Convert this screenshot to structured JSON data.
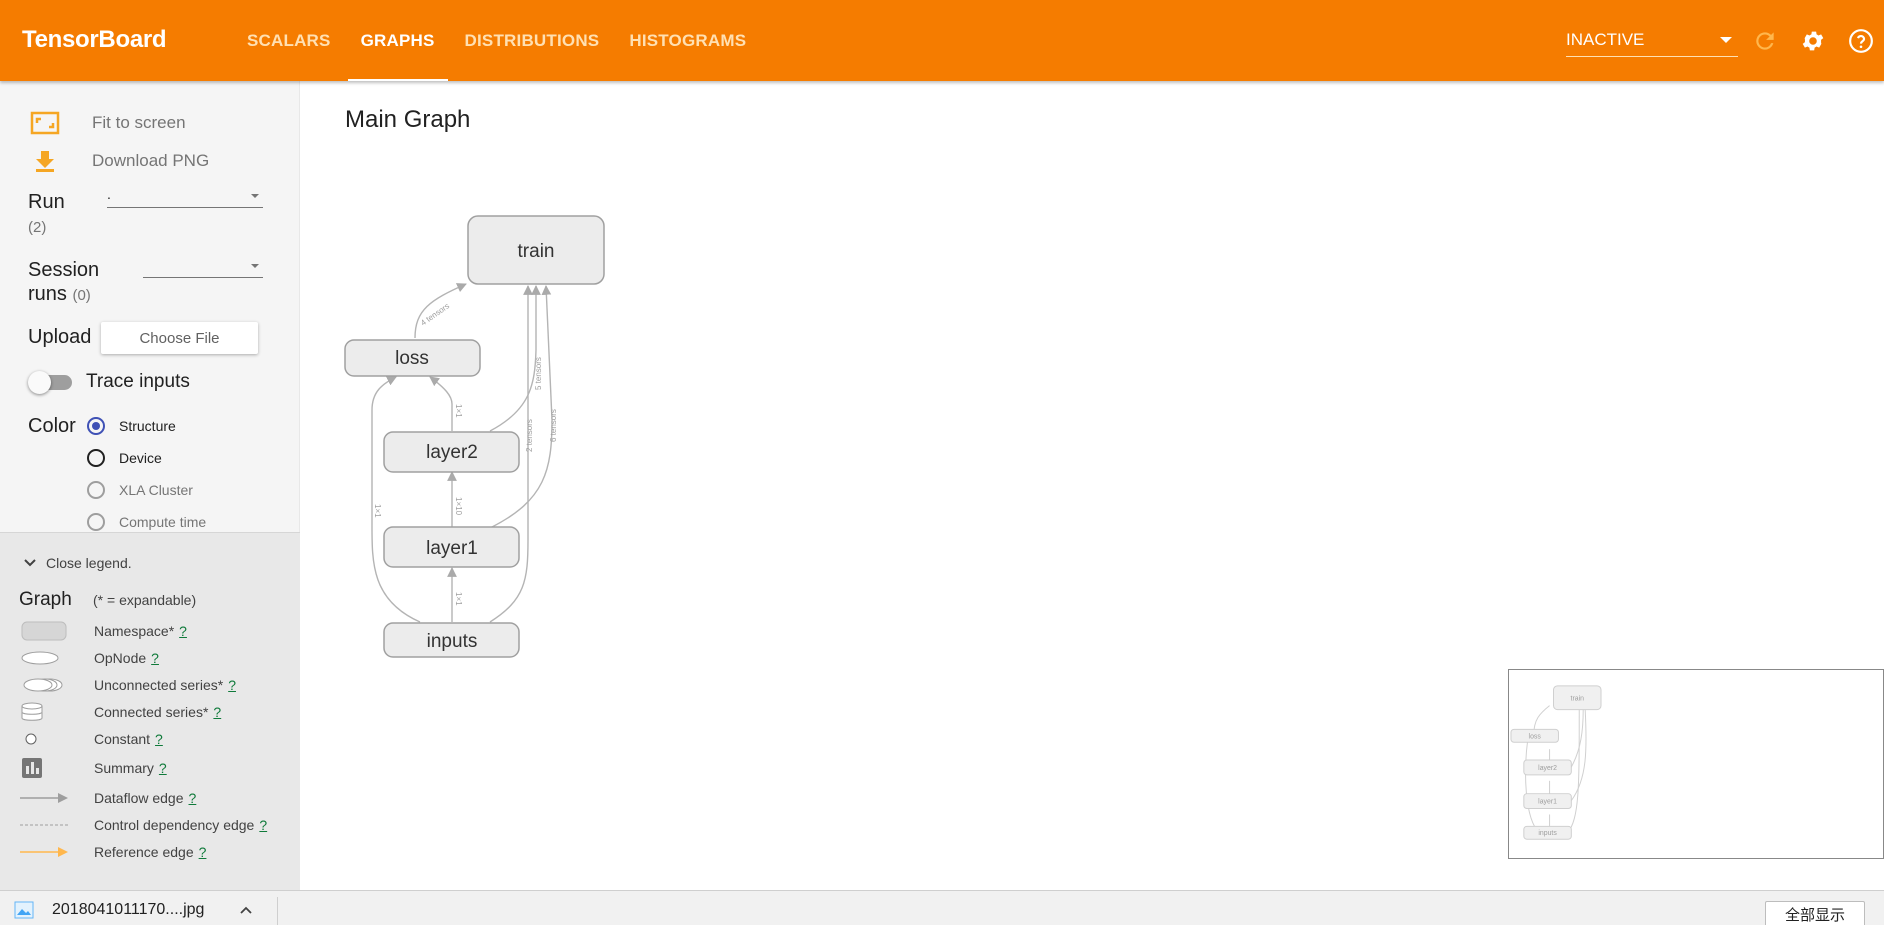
{
  "header": {
    "brand": "TensorBoard",
    "tabs": [
      {
        "label": "SCALARS",
        "active": false
      },
      {
        "label": "GRAPHS",
        "active": true
      },
      {
        "label": "DISTRIBUTIONS",
        "active": false
      },
      {
        "label": "HISTOGRAMS",
        "active": false
      }
    ],
    "run_status": "INACTIVE",
    "icons": [
      "refresh-icon",
      "settings-icon",
      "help-icon"
    ],
    "accent_color": "#f57c00"
  },
  "sidebar": {
    "fit_label": "Fit to screen",
    "download_label": "Download PNG",
    "run_label": "Run",
    "run_count": "(2)",
    "run_value": ".",
    "session_label_1": "Session",
    "session_label_2": "runs",
    "session_count": "(0)",
    "session_value": "",
    "upload_label": "Upload",
    "choose_file": "Choose File",
    "trace_label": "Trace inputs",
    "trace_on": false,
    "color_label": "Color",
    "color_options": [
      {
        "label": "Structure",
        "checked": true
      },
      {
        "label": "Device",
        "checked": false
      },
      {
        "label": "XLA Cluster",
        "checked": false
      },
      {
        "label": "Compute time",
        "checked": false
      }
    ]
  },
  "legend": {
    "close_label": "Close legend.",
    "title": "Graph",
    "note": "(* = expandable)",
    "help": "?",
    "items": [
      {
        "label": "Namespace*"
      },
      {
        "label": "OpNode"
      },
      {
        "label": "Unconnected series*"
      },
      {
        "label": "Connected series*"
      },
      {
        "label": "Constant"
      },
      {
        "label": "Summary"
      },
      {
        "label": "Dataflow edge"
      },
      {
        "label": "Control dependency edge"
      },
      {
        "label": "Reference edge"
      }
    ]
  },
  "main": {
    "title": "Main Graph",
    "nodes": [
      "train",
      "loss",
      "layer2",
      "layer1",
      "inputs"
    ],
    "edge_labels": {
      "loss_train": "4 tensors",
      "layer2_loss": "1×1",
      "layer1_layer2": "1×10",
      "inputs_layer1": "1×1",
      "inputs_loss": "1×1",
      "inputs_train": "2 tensors",
      "layer2_train": "5 tensors",
      "layer1_train": "6 tensors"
    }
  },
  "download_bar": {
    "filename": "2018041011170....jpg",
    "show_all": "全部显示"
  }
}
